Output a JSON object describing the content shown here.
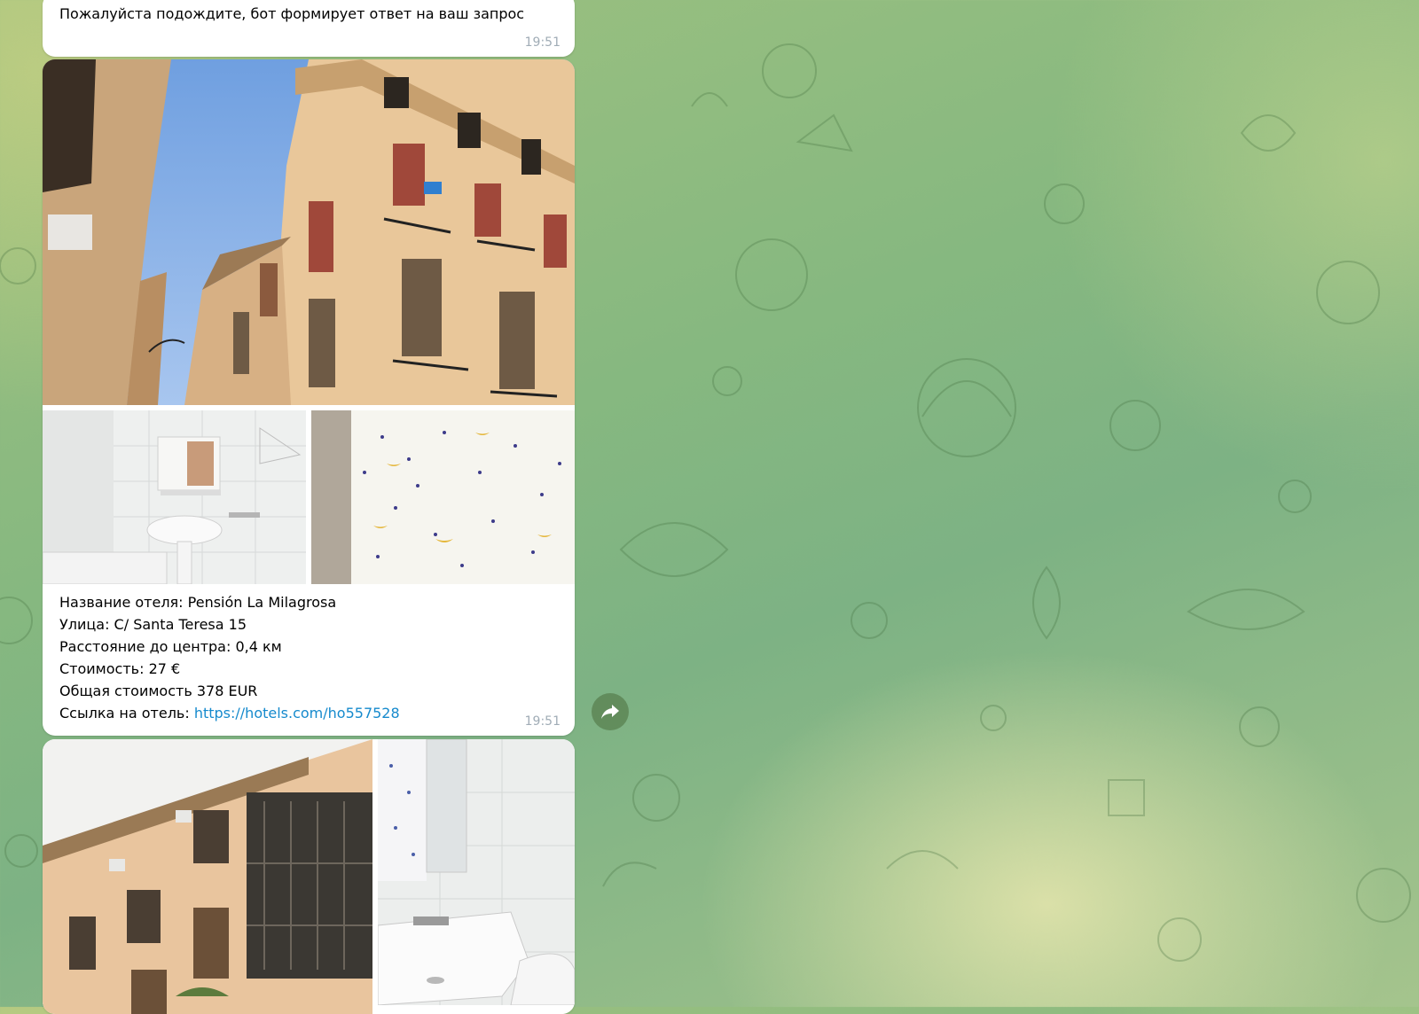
{
  "messages": [
    {
      "text": "Пожалуйста подождите, бот формирует ответ на ваш запрос",
      "time": "19:51"
    },
    {
      "photos": [
        "building-photo",
        "bathroom-photo",
        "shower-curtain-photo"
      ],
      "caption": {
        "hotel_name": "Название отеля: Pensión La Milagrosa",
        "street": "Улица: C/ Santa Teresa 15",
        "distance": "Расстояние до центра: 0,4 км",
        "price": "Стоимость: 27 €",
        "total": "Общая стоимость 378 EUR",
        "link_label": "Ссылка на отель: ",
        "link_url": "https://hotels.com/ho557528"
      },
      "time": "19:51"
    },
    {
      "photos": [
        "facade-photo",
        "sink-photo"
      ]
    }
  ],
  "forward_button": {
    "icon": "forward-arrow-icon"
  }
}
